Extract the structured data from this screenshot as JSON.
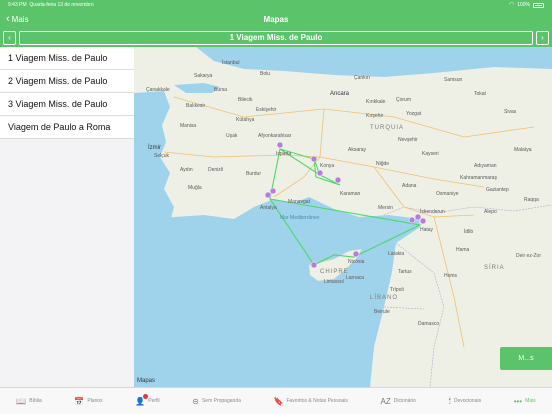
{
  "status": {
    "time": "9:43 PM",
    "date": "Quarta-feira 13 de novembro",
    "battery": "100%"
  },
  "nav": {
    "back_label": "Mais",
    "title": "Mapas"
  },
  "route": {
    "current": "1 Viagem Miss. de Paulo",
    "prev_icon": "chevron-left-icon",
    "next_icon": "chevron-right-icon"
  },
  "sidebar": {
    "items": [
      {
        "label": "1 Viagem Miss. de Paulo"
      },
      {
        "label": "2 Viagem Miss. de Paulo"
      },
      {
        "label": "3 Viagem Miss. de Paulo"
      },
      {
        "label": "Viagem de Paulo a Roma"
      }
    ]
  },
  "map": {
    "labels": {
      "istanbul": "İstanbul",
      "ankara": "Ancara",
      "turquia": "TURQUIA",
      "izmir": "İzmir",
      "konya": "Konya",
      "antalya": "Antalya",
      "chipre": "CHIPRE",
      "libano": "LÍBANO",
      "siria": "SÍRIA",
      "bursa": "Bursa",
      "eskisehir": "Eskişehir",
      "kayseri": "Kayseri",
      "adana": "Adana",
      "mersin": "Mersin",
      "hatay": "Hatay",
      "karaman": "Karaman",
      "afyon": "Afyonkarahisar",
      "denizli": "Denizli",
      "aydin": "Aydın",
      "manisa": "Manisa",
      "balikesir": "Balıkesir",
      "canakkale": "Çanakkale",
      "samsun": "Samsun",
      "sivas": "Sivas",
      "malatya": "Malatya",
      "gaziantep": "Gaziantep",
      "kahraman": "Kahramanmaraş",
      "aleppo": "Alepo",
      "hama": "Hama",
      "homs": "Homs",
      "beirut": "Beirute",
      "latakia": "Latakia",
      "nicosia": "Nicósia",
      "limassol": "Limassol",
      "larnaca": "Larnaca",
      "manavgat": "Manavgat",
      "isparta": "Isparta",
      "kutahya": "Kütahya",
      "usak": "Uşak",
      "burdur": "Burdur",
      "aksaray": "Aksaray",
      "nigde": "Niğde",
      "nevsehir": "Nevşehir",
      "kirsehir": "Kırşehir",
      "yozgat": "Yozgat",
      "corum": "Çorum",
      "kirikkale": "Kırıkkale",
      "mediterraneo": "Mar Mediterrâneo",
      "sakarya": "Sakarya",
      "bilecik": "Bilecik",
      "bolu": "Bolu",
      "cankiri": "Çankırı",
      "tokat": "Tokat",
      "adiyaman": "Adıyaman",
      "osmaniye": "Osmaniye",
      "iskenderun": "İskenderun",
      "idlib": "İdlib",
      "tripoli": "Trípoli",
      "tartus": "Tartus",
      "raqqa": "Raqqa",
      "deir": "Deir ez-Zor",
      "damasco": "Damasco",
      "selcuk": "Selçuk",
      "mugla": "Muğla"
    },
    "logo_text": "Mapas",
    "button_label": "M...s"
  },
  "tabs": [
    {
      "label": "Bíblia",
      "icon": "book-icon",
      "glyph": "📖",
      "active": false
    },
    {
      "label": "Planos",
      "icon": "calendar-icon",
      "glyph": "📅",
      "active": false
    },
    {
      "label": "Perfil",
      "icon": "person-icon",
      "glyph": "👤",
      "active": false,
      "badge": true
    },
    {
      "label": "Sem Propaganda",
      "icon": "no-ads-icon",
      "glyph": "⊝",
      "active": false
    },
    {
      "label": "Favoritos & Notas Pessoais",
      "icon": "bookmark-icon",
      "glyph": "🔖",
      "active": false
    },
    {
      "label": "Dicionário",
      "icon": "dictionary-icon",
      "glyph": "AZ",
      "active": false
    },
    {
      "label": "Devocionais",
      "icon": "devotional-icon",
      "glyph": "🕯",
      "active": false
    },
    {
      "label": "Mais",
      "icon": "more-icon",
      "glyph": "•••",
      "active": true
    }
  ],
  "colors": {
    "accent": "#5bc46a",
    "route_line": "#4cd964",
    "pin": "#b77dd9",
    "sea": "#9fd3ec",
    "land": "#eef0e6"
  }
}
